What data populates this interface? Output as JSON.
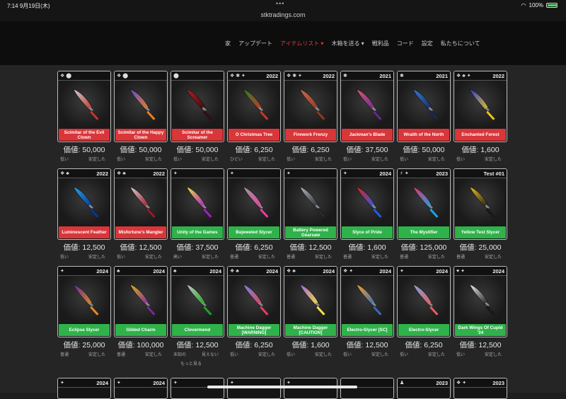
{
  "status": {
    "time": "7:14",
    "date": "9月19日(木)",
    "battery": "100%",
    "battery_level": 1.0
  },
  "browser": {
    "url": "stktradings.com"
  },
  "nav": [
    {
      "label": "家",
      "active": false
    },
    {
      "label": "アップデート",
      "active": false
    },
    {
      "label": "アイテムリスト ▾",
      "active": true
    },
    {
      "label": "木箱を送る ▾",
      "active": false
    },
    {
      "label": "戦利品",
      "active": false
    },
    {
      "label": "コード",
      "active": false
    },
    {
      "label": "設定",
      "active": false
    },
    {
      "label": "私たちについて",
      "active": false
    }
  ],
  "value_prefix": "価値: ",
  "more_label": "もっと見る",
  "items": [
    {
      "name": "Scimitar of the Evil Clown",
      "badges": "❖ ⬤",
      "year": "",
      "value": "価値: 50,000",
      "demand": "低い",
      "stability": "安定した",
      "bar": "red",
      "c1": "#cfcfcf",
      "c2": "#c0392b"
    },
    {
      "name": "Scimitar of the Happy Clown",
      "badges": "❖ ⬤",
      "year": "",
      "value": "価値: 50,000",
      "demand": "低い",
      "stability": "安定した",
      "bar": "red",
      "c1": "#5a4fcf",
      "c2": "#e67e22"
    },
    {
      "name": "Scimitar of the Screamer",
      "badges": "⬤",
      "year": "",
      "value": "価値: 50,000",
      "demand": "低い",
      "stability": "安定した",
      "bar": "red",
      "c1": "#b0202a",
      "c2": "#3a0d0d"
    },
    {
      "name": "O Christmas Tree",
      "badges": "❖ ✱ ✦",
      "year": "2022",
      "value": "価値: 6,250",
      "demand": "ひどい",
      "stability": "安定した",
      "bar": "red",
      "c1": "#2f7a2a",
      "c2": "#c0392b"
    },
    {
      "name": "Firework Frenzy",
      "badges": "❖ ✱ ✦",
      "year": "2022",
      "value": "価値: 6,250",
      "demand": "低い",
      "stability": "安定した",
      "bar": "red",
      "c1": "#c96a4a",
      "c2": "#8a3a2a"
    },
    {
      "name": "Jackman's Blade",
      "badges": "✱",
      "year": "2021",
      "value": "価値: 37,500",
      "demand": "低い",
      "stability": "安定した",
      "bar": "red",
      "c1": "#d65a7a",
      "c2": "#6a2a8a"
    },
    {
      "name": "Wraith of the North",
      "badges": "✱",
      "year": "2021",
      "value": "価値: 50,000",
      "demand": "低い",
      "stability": "安定した",
      "bar": "red",
      "c1": "#3a7ad6",
      "c2": "#1a2a5a"
    },
    {
      "name": "Enchanted Forest",
      "badges": "❖ ♣ ✦",
      "year": "2022",
      "value": "価値: 1,600",
      "demand": "低い",
      "stability": "安定した",
      "bar": "red",
      "c1": "#2a3ad6",
      "c2": "#e0c020"
    },
    {
      "name": "Luminescent Feather",
      "badges": "❖ ♣",
      "year": "2022",
      "value": "価値: 12,500",
      "demand": "低い",
      "stability": "安定した",
      "bar": "red",
      "c1": "#2aa0e6",
      "c2": "#0a3a8a"
    },
    {
      "name": "Misfortune's Mangler",
      "badges": "❖ ♣",
      "year": "2022",
      "value": "価値: 12,500",
      "demand": "低い",
      "stability": "安定した",
      "bar": "red",
      "c1": "#cfcfcf",
      "c2": "#9a1a2a"
    },
    {
      "name": "Unity of the Games",
      "badges": "✦",
      "year": "",
      "value": "価値: 37,500",
      "demand": "高い",
      "stability": "安定した",
      "bar": "green",
      "c1": "#f2e040",
      "c2": "#a020c0"
    },
    {
      "name": "Bejeweled Slycer",
      "badges": "✦",
      "year": "",
      "value": "価値: 6,250",
      "demand": "普通",
      "stability": "安定した",
      "bar": "green",
      "c1": "#9a9a9a",
      "c2": "#e040a0"
    },
    {
      "name": "Battery Powered Gearsaw",
      "badges": "✦",
      "year": "",
      "value": "価値: 12,500",
      "demand": "普通",
      "stability": "安定した",
      "bar": "green",
      "c1": "#b0b8c0",
      "c2": "#2a2a2a"
    },
    {
      "name": "Slyce of Pride",
      "badges": "✦",
      "year": "2024",
      "value": "価値: 1,600",
      "demand": "普通",
      "stability": "安定した",
      "bar": "green",
      "c1": "#e02020",
      "c2": "#2060e0"
    },
    {
      "name": "The Mystifier",
      "badges": "⚡ ✦",
      "year": "2023",
      "value": "価値: 125,000",
      "demand": "普通",
      "stability": "安定した",
      "bar": "green",
      "c1": "#e0306a",
      "c2": "#20a0e0"
    },
    {
      "name": "Yellow Test Slycer",
      "badges": "",
      "year": "Test #01",
      "value": "価値: 25,000",
      "demand": "普通",
      "stability": "安定した",
      "bar": "green",
      "c1": "#e8c020",
      "c2": "#1a1a1a"
    },
    {
      "name": "Eclipse Slycer",
      "badges": "✦",
      "year": "2024",
      "value": "価値: 25,000",
      "demand": "普通",
      "stability": "安定した",
      "bar": "green",
      "c1": "#5a2a9a",
      "c2": "#e08a20"
    },
    {
      "name": "Gilded Charm",
      "badges": "♣",
      "year": "2024",
      "value": "価値: 100,000",
      "demand": "普通",
      "stability": "安定した",
      "bar": "green",
      "c1": "#e0b020",
      "c2": "#7a2a9a"
    },
    {
      "name": "Clovermend",
      "badges": "♣",
      "year": "2024",
      "value": "価値: 12,500",
      "demand": "未知の",
      "stability": "見えない",
      "bar": "green",
      "c1": "#c0c8c0",
      "c2": "#2a9a2a"
    },
    {
      "name": "Machine Dagger [WARNING]",
      "badges": "❖ ♣",
      "year": "2024",
      "value": "価値: 6,250",
      "demand": "低い",
      "stability": "安定した",
      "bar": "green",
      "c1": "#6a8ae0",
      "c2": "#e04060"
    },
    {
      "name": "Machine Dagger [CAUTION]",
      "badges": "❖ ♣",
      "year": "2024",
      "value": "価値: 1,600",
      "demand": "低い",
      "stability": "安定した",
      "bar": "green",
      "c1": "#a060e0",
      "c2": "#f0e040"
    },
    {
      "name": "Electro-Slycer [SC]",
      "badges": "❖ ✦",
      "year": "2024",
      "value": "価値: 12,500",
      "demand": "低い",
      "stability": "安定した",
      "bar": "green",
      "c1": "#f0a030",
      "c2": "#3a6ab0"
    },
    {
      "name": "Electro-Slycer",
      "badges": "✦",
      "year": "2024",
      "value": "価値: 6,250",
      "demand": "低い",
      "stability": "安定した",
      "bar": "green",
      "c1": "#80a0e0",
      "c2": "#e06060"
    },
    {
      "name": "Dark Wings Of Cupid '24",
      "badges": "♥ ✦",
      "year": "2024",
      "value": "価値: 12,500",
      "demand": "低い",
      "stability": "安定した",
      "bar": "green",
      "c1": "#f0f0f0",
      "c2": "#1a1a1a"
    }
  ],
  "row4": [
    {
      "badges": "✦",
      "year": "2024"
    },
    {
      "badges": "✦",
      "year": "2024"
    },
    {
      "badges": "✦",
      "year": ""
    },
    {
      "badges": "✦",
      "year": ""
    },
    {
      "badges": "✦",
      "year": ""
    },
    {
      "badges": "",
      "year": ""
    },
    {
      "badges": "♟",
      "year": "2023"
    },
    {
      "badges": "❖ ✦",
      "year": "2023"
    }
  ]
}
